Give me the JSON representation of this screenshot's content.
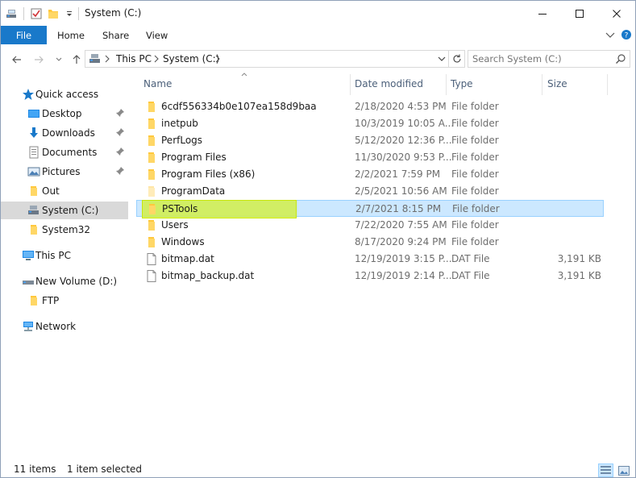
{
  "window": {
    "title": "System (C:)",
    "accent": "#1979ca"
  },
  "ribbon": {
    "file_label": "File",
    "tabs": [
      "Home",
      "Share",
      "View"
    ]
  },
  "address": {
    "crumbs": [
      "This PC",
      "System (C:)"
    ],
    "search_placeholder": "Search System (C:)"
  },
  "nav": {
    "quick_access": "Quick access",
    "items": [
      {
        "label": "Desktop",
        "icon": "desktop-icon",
        "pinned": true
      },
      {
        "label": "Downloads",
        "icon": "download-icon",
        "pinned": true
      },
      {
        "label": "Documents",
        "icon": "documents-icon",
        "pinned": true
      },
      {
        "label": "Pictures",
        "icon": "pictures-icon",
        "pinned": true
      },
      {
        "label": "Out",
        "icon": "folder-icon",
        "pinned": false
      },
      {
        "label": "System (C:)",
        "icon": "drive-icon",
        "pinned": false,
        "selected": true
      },
      {
        "label": "System32",
        "icon": "folder-icon",
        "pinned": false
      }
    ],
    "this_pc": "This PC",
    "new_volume": "New Volume (D:)",
    "ftp": "FTP",
    "network": "Network"
  },
  "columns": {
    "name": "Name",
    "date": "Date modified",
    "type": "Type",
    "size": "Size"
  },
  "files": [
    {
      "name": "6cdf556334b0e107ea158d9baa",
      "date": "2/18/2020 4:53 PM",
      "type": "File folder",
      "size": "",
      "kind": "folder"
    },
    {
      "name": "inetpub",
      "date": "10/3/2019 10:05 A...",
      "type": "File folder",
      "size": "",
      "kind": "folder"
    },
    {
      "name": "PerfLogs",
      "date": "5/12/2020 12:36 P...",
      "type": "File folder",
      "size": "",
      "kind": "folder"
    },
    {
      "name": "Program Files",
      "date": "11/30/2020 9:53 P...",
      "type": "File folder",
      "size": "",
      "kind": "folder"
    },
    {
      "name": "Program Files (x86)",
      "date": "2/2/2021 7:59 PM",
      "type": "File folder",
      "size": "",
      "kind": "folder"
    },
    {
      "name": "ProgramData",
      "date": "2/5/2021 10:56 AM",
      "type": "File folder",
      "size": "",
      "kind": "folder-faded"
    },
    {
      "name": "PSTools",
      "date": "2/7/2021 8:15 PM",
      "type": "File folder",
      "size": "",
      "kind": "folder",
      "selected": true
    },
    {
      "name": "Users",
      "date": "7/22/2020 7:55 AM",
      "type": "File folder",
      "size": "",
      "kind": "folder"
    },
    {
      "name": "Windows",
      "date": "8/17/2020 9:24 PM",
      "type": "File folder",
      "size": "",
      "kind": "folder"
    },
    {
      "name": "bitmap.dat",
      "date": "12/19/2019 3:15 P...",
      "type": "DAT File",
      "size": "3,191 KB",
      "kind": "file"
    },
    {
      "name": "bitmap_backup.dat",
      "date": "12/19/2019 2:14 P...",
      "type": "DAT File",
      "size": "3,191 KB",
      "kind": "file"
    }
  ],
  "status": {
    "count": "11 items",
    "selection": "1 item selected"
  }
}
